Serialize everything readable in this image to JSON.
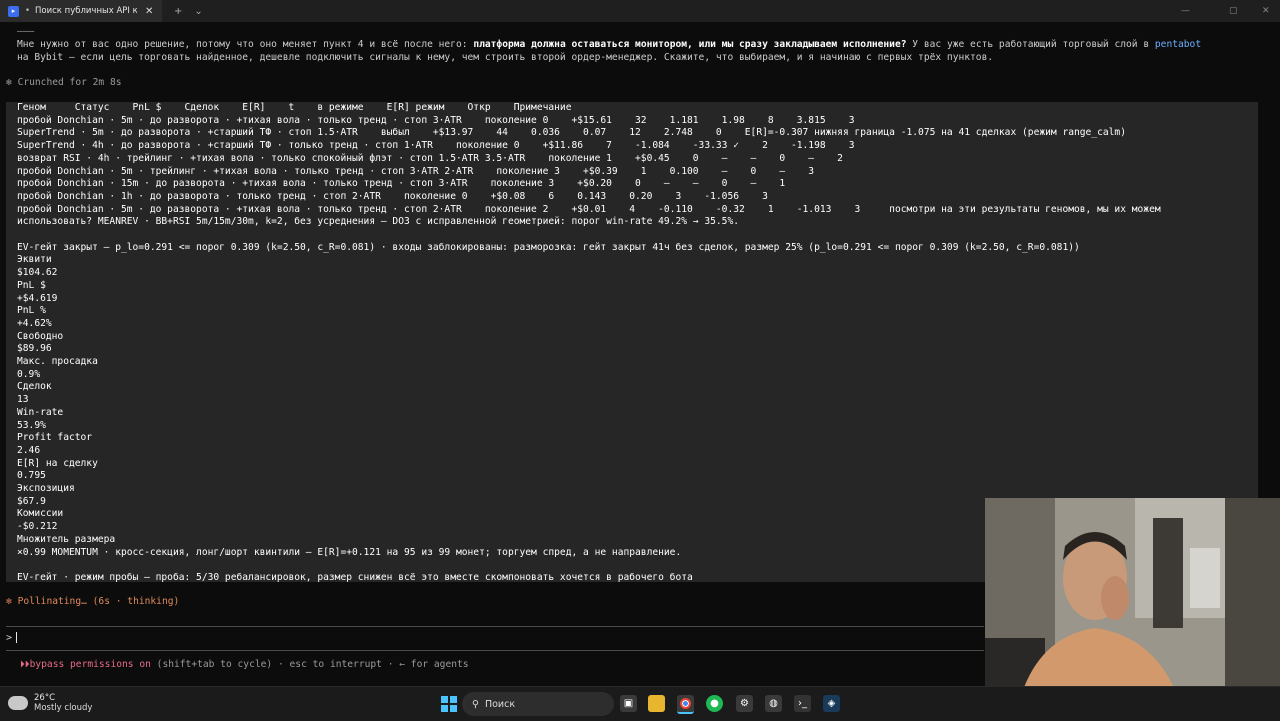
{
  "window": {
    "tab_title": "Поиск публичных API криптобирж",
    "new_tab": "+",
    "dropdown": "⌄",
    "close": "✕",
    "minimize": "—",
    "maximize": "▢"
  },
  "terminal": {
    "top_divider": "———",
    "intro_line1_a": "Мне нужно от вас одно решение, потому что оно меняет пункт 4 и всё после него: ",
    "intro_line1_bold": "платформа должна оставаться монитором, или мы сразу закладываем исполнение?",
    "intro_line1_c": " У вас уже есть работающий торговый слой в ",
    "intro_line1_link": "pentabot",
    "intro_line2": "на Bybit — если цель торговать найденное, дешевле подключить сигналы к нему, чем строить второй ордер-менеджер. Скажите, что выбираем, и я начинаю с первых трёх пунктов.",
    "crunched": "Crunched for 2m 8s",
    "selected_lines": [
      "Геном     Статус    PnL $    Сделок    E[R]    t    в режиме    E[R] режим    Откр    Примечание",
      "пробой Donchian · 5m · до разворота · +тихая вола · только тренд · стоп 3·ATR    поколение 0    +$15.61    32    1.181    1.98    8    3.815    3",
      "SuperTrend · 5m · до разворота · +старший ТФ · стоп 1.5·ATR    выбыл    +$13.97    44    0.036    0.07    12    2.748    0    E[R]=-0.307 нижняя граница -1.075 на 41 сделках (режим range_calm)",
      "SuperTrend · 4h · до разворота · +старший ТФ · только тренд · стоп 1·ATR    поколение 0    +$11.86    7    -1.084    -33.33 ✓    2    -1.198    3",
      "возврат RSI · 4h · трейлинг · +тихая вола · только спокойный флэт · стоп 1.5·ATR 3.5·ATR    поколение 1    +$0.45    0    —    —    0    —    2",
      "пробой Donchian · 5m · трейлинг · +тихая вола · только тренд · стоп 3·ATR 2·ATR    поколение 3    +$0.39    1    0.100    —    0    —    3",
      "пробой Donchian · 15m · до разворота · +тихая вола · только тренд · стоп 3·ATR    поколение 3    +$0.20    0    —    —    0    —    1",
      "пробой Donchian · 1h · до разворота · только тренд · стоп 2·ATR    поколение 0    +$0.08    6    0.143    0.20    3    -1.056    3",
      "пробой Donchian · 5m · до разворота · +тихая вола · только тренд · стоп 2·ATR    поколение 2    +$0.01    4    -0.110    -0.32    1    -1.013    3     посмотри на эти результаты геномов, мы их можем",
      "использовать? MEANREV · BB+RSI 5m/15m/30m, k=2, без усреднения — DO3 с исправленной геометрией: порог win-rate 49.2% → 35.5%.",
      "",
      "EV-гейт закрыт — p_lo=0.291 <= порог 0.309 (k=2.50, c_R=0.081) · входы заблокированы: разморозка: гейт закрыт 41ч без сделок, размер 25% (p_lo=0.291 <= порог 0.309 (k=2.50, c_R=0.081))",
      "Эквити",
      "$104.62",
      "PnL $",
      "+$4.619",
      "PnL %",
      "+4.62%",
      "Свободно",
      "$89.96",
      "Макс. просадка",
      "0.9%",
      "Сделок",
      "13",
      "Win-rate",
      "53.9%",
      "Profit factor",
      "2.46",
      "E[R] на сделку",
      "0.795",
      "Экспозиция",
      "$67.9",
      "Комиссии",
      "-$0.212",
      "Множитель размера",
      "×0.99 MOMENTUM · кросс-секция, лонг/шорт квинтили — E[R]=+0.121 на 95 из 99 монет; торгуем спред, а не направление.",
      "",
      "EV-гейт · режим пробы — проба: 5/30 ребалансировок, размер снижен всё это вместе скомпоновать хочется в рабочего бота"
    ],
    "status": "Pollinating… (6s · thinking)",
    "prompt_symbol": ">",
    "footer_arrows": "⏵⏵",
    "footer_bypass": "bypass permissions on",
    "footer_rest": " (shift+tab to cycle) · esc to interrupt · ← for agents"
  },
  "taskbar": {
    "temperature": "26°C",
    "weather": "Mostly cloudy",
    "search_placeholder": "Поиск"
  },
  "colors": {
    "terminal_bg": "#0c0c0c",
    "selection_bg": "#262626",
    "accent_orange": "#d77757",
    "bypass_pink": "#e76a8a",
    "link_blue": "#6ab0ff"
  }
}
